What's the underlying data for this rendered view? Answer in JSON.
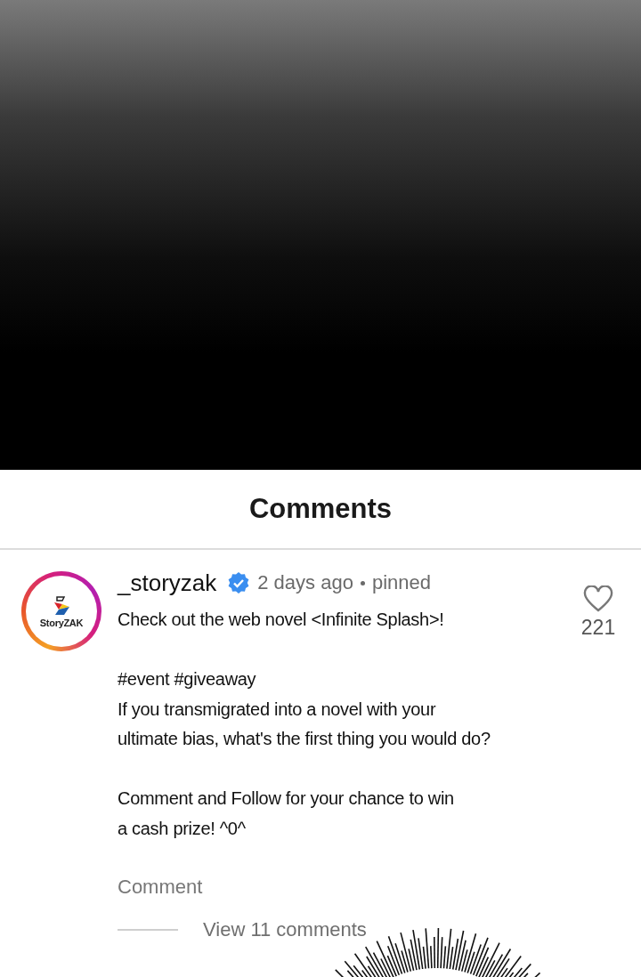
{
  "panel_title": "Comments",
  "comments": [
    {
      "avatar_logo_text": "StoryZAK",
      "author": "_storyzak",
      "verified": true,
      "time": "2 days ago",
      "pinned_label": "pinned",
      "likes": "221",
      "liked": false,
      "body": [
        [
          "Check out the web novel <Infinite Splash>!"
        ],
        [
          "#event #giveaway",
          "If you transmigrated into a novel with your",
          "ultimate bias, what's the first thing you would do?"
        ],
        [
          "Comment and Follow for your chance to win",
          "a cash prize! ^0^"
        ]
      ],
      "reply_label": "Comment",
      "view_replies": "View 11 comments"
    }
  ]
}
